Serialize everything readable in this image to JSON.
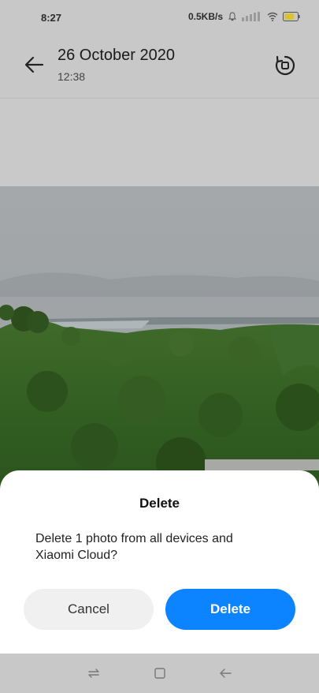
{
  "status_bar": {
    "time": "8:27",
    "network_speed": "0.5KB/s",
    "icons": [
      "bell-icon",
      "signal-icon",
      "wifi-icon",
      "battery-icon"
    ]
  },
  "header": {
    "title": "26 October 2020",
    "subtitle": "12:38",
    "back_icon": "arrow-left-icon",
    "rotate_icon": "rotate-icon"
  },
  "photo": {
    "description_icon": "landscape-photo"
  },
  "dialog": {
    "title": "Delete",
    "message": "Delete 1 photo from all devices and Xiaomi Cloud?",
    "cancel_label": "Cancel",
    "delete_label": "Delete",
    "accent_color": "#0d84ff"
  },
  "nav_bar": {
    "icons": [
      "menu-icon",
      "home-icon",
      "back-icon"
    ]
  }
}
